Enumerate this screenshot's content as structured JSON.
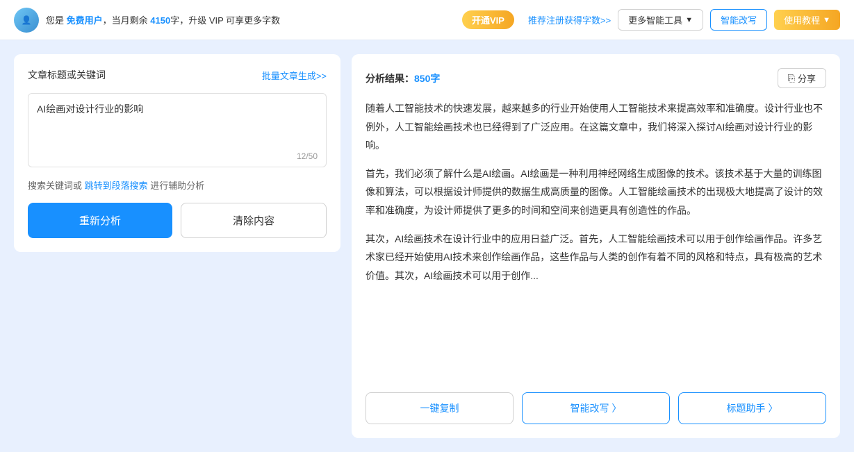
{
  "topbar": {
    "user_info": "您是 免费用户，当月剩余 4150字，升级 VIP 可享更多字数",
    "free_text": "免费用户",
    "remaining_chars": "4150",
    "vip_promo": "升级 VIP 可享更多字数",
    "btn_vip_label": "开通VIP",
    "btn_register_label": "推荐注册获得字数>>",
    "btn_tools_label": "更多智能工具",
    "btn_rewrite_label": "智能改写",
    "btn_tutorial_label": "使用教程"
  },
  "left": {
    "panel_title": "文章标题或关键词",
    "batch_link": "批量文章生成>>",
    "textarea_value": "AI绘画对设计行业的影响",
    "char_count": "12/50",
    "helper_text1": "搜索关键词或",
    "helper_link1": "跳转到段落搜索",
    "helper_text2": "进行辅助分析",
    "btn_reanalyze": "重新分析",
    "btn_clear": "清除内容"
  },
  "right": {
    "result_label": "分析结果：",
    "word_count": "850字",
    "btn_share_label": "分享",
    "paragraphs": [
      "随着人工智能技术的快速发展，越来越多的行业开始使用人工智能技术来提高效率和准确度。设计行业也不例外，人工智能绘画技术也已经得到了广泛应用。在这篇文章中，我们将深入探讨AI绘画对设计行业的影响。",
      "首先，我们必须了解什么是AI绘画。AI绘画是一种利用神经网络生成图像的技术。该技术基于大量的训练图像和算法，可以根据设计师提供的数据生成高质量的图像。人工智能绘画技术的出现极大地提高了设计的效率和准确度，为设计师提供了更多的时间和空间来创造更具有创造性的作品。",
      "其次，AI绘画技术在设计行业中的应用日益广泛。首先，人工智能绘画技术可以用于创作绘画作品。许多艺术家已经开始使用AI技术来创作绘画作品，这些作品与人类的创作有着不同的风格和特点，具有极高的艺术价值。其次，AI绘画技术可以用于创作..."
    ],
    "btn_copy": "一键复制",
    "btn_smart_rewrite": "智能改写 〉",
    "btn_title_helper": "标题助手 〉"
  }
}
